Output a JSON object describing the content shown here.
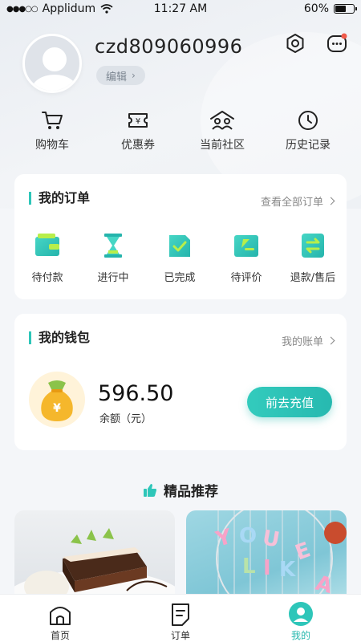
{
  "status_bar": {
    "carrier": "Applidum",
    "time": "11:27 AM",
    "battery": "60%",
    "battery_level": 0.6
  },
  "profile": {
    "username": "czd809060996",
    "edit_label": "编辑"
  },
  "quick_nav": [
    {
      "label": "购物车",
      "icon": "cart-icon"
    },
    {
      "label": "优惠券",
      "icon": "coupon-icon"
    },
    {
      "label": "当前社区",
      "icon": "community-icon"
    },
    {
      "label": "历史记录",
      "icon": "history-icon"
    }
  ],
  "orders": {
    "title": "我的订单",
    "link": "查看全部订单",
    "items": [
      {
        "label": "待付款",
        "icon": "wallet-icon"
      },
      {
        "label": "进行中",
        "icon": "hourglass-icon"
      },
      {
        "label": "已完成",
        "icon": "completed-doc-icon"
      },
      {
        "label": "待评价",
        "icon": "review-icon"
      },
      {
        "label": "退款/售后",
        "icon": "refund-icon"
      }
    ]
  },
  "wallet": {
    "title": "我的钱包",
    "link": "我的账单",
    "balance": "596.50",
    "balance_label": "余额（元）",
    "recharge": "前去充值",
    "bag_symbol": "¥"
  },
  "recommend": {
    "title": "精品推荐"
  },
  "tabbar": [
    {
      "label": "首页",
      "icon": "home-icon"
    },
    {
      "label": "订单",
      "icon": "order-icon"
    },
    {
      "label": "我的",
      "icon": "profile-icon"
    }
  ],
  "colors": {
    "accent": "#2ec6b9",
    "background": "#f4f6f9",
    "gold": "#f5b72c"
  }
}
